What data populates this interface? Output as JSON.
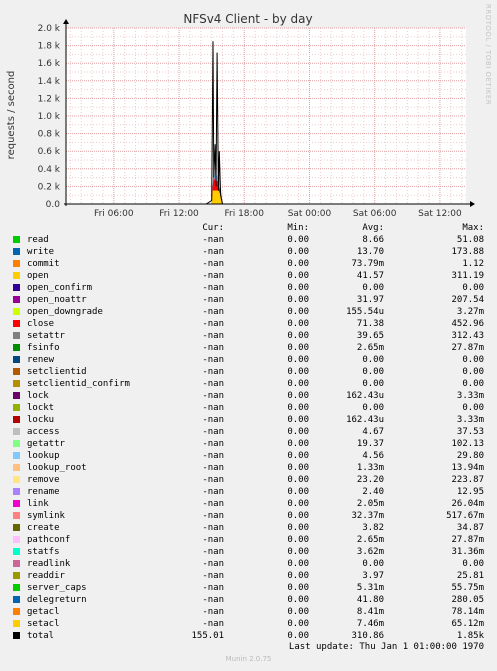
{
  "chart_data": {
    "type": "area",
    "title": "NFSv4 Client - by day",
    "ylabel": "requests / second",
    "ylim": [
      0,
      2000
    ],
    "yticks": [
      "0.0",
      "0.2 k",
      "0.4 k",
      "0.6 k",
      "0.8 k",
      "1.0 k",
      "1.2 k",
      "1.4 k",
      "1.6 k",
      "1.8 k",
      "2.0 k"
    ],
    "xticks": [
      "Fri 06:00",
      "Fri 12:00",
      "Fri 18:00",
      "Sat 00:00",
      "Sat 06:00",
      "Sat 12:00"
    ],
    "xticks_hours": [
      6,
      12,
      18,
      24,
      30,
      36
    ],
    "xlim_hours": [
      1.6,
      38.4
    ],
    "grid": true,
    "series": [
      {
        "name": "total",
        "x_hours": [
          12.0,
          13.5,
          14.5,
          15.0,
          15.12,
          15.2,
          15.32,
          15.4,
          15.5,
          15.62,
          15.7,
          15.82,
          16.0,
          17.0
        ],
        "y": [
          0,
          0,
          0,
          40,
          1850,
          300,
          680,
          200,
          1720,
          150,
          600,
          100,
          0,
          0
        ]
      },
      {
        "name": "lookup",
        "x_hours": [
          15.0,
          15.12,
          15.2,
          15.32,
          15.5,
          15.62,
          15.7,
          15.82,
          16.0
        ],
        "y": [
          0,
          220,
          420,
          260,
          320,
          250,
          400,
          180,
          0
        ]
      },
      {
        "name": "close",
        "x_hours": [
          15.0,
          15.12,
          15.2,
          15.32,
          15.5,
          15.62,
          15.8,
          16.0
        ],
        "y": [
          0,
          200,
          300,
          250,
          260,
          200,
          150,
          0
        ]
      },
      {
        "name": "open",
        "x_hours": [
          15.0,
          15.12,
          15.2,
          15.32,
          15.5,
          15.62,
          15.8,
          16.0
        ],
        "y": [
          0,
          150,
          150,
          150,
          150,
          150,
          100,
          0
        ]
      }
    ]
  },
  "legend": {
    "headers": {
      "cur": "Cur:",
      "min": "Min:",
      "avg": "Avg:",
      "max": "Max:"
    },
    "rows": [
      {
        "name": "read",
        "color": "#00cc00",
        "cur": "-nan",
        "min": "0.00",
        "avg": "8.66",
        "max": "51.08"
      },
      {
        "name": "write",
        "color": "#0066b3",
        "cur": "-nan",
        "min": "0.00",
        "avg": "13.70",
        "max": "173.88"
      },
      {
        "name": "commit",
        "color": "#ff8000",
        "cur": "-nan",
        "min": "0.00",
        "avg": "73.79m",
        "max": "1.12"
      },
      {
        "name": "open",
        "color": "#ffcc00",
        "cur": "-nan",
        "min": "0.00",
        "avg": "41.57",
        "max": "311.19"
      },
      {
        "name": "open_confirm",
        "color": "#330099",
        "cur": "-nan",
        "min": "0.00",
        "avg": "0.00",
        "max": "0.00"
      },
      {
        "name": "open_noattr",
        "color": "#990099",
        "cur": "-nan",
        "min": "0.00",
        "avg": "31.97",
        "max": "207.54"
      },
      {
        "name": "open_downgrade",
        "color": "#ccff00",
        "cur": "-nan",
        "min": "0.00",
        "avg": "155.54u",
        "max": "3.27m"
      },
      {
        "name": "close",
        "color": "#ff0000",
        "cur": "-nan",
        "min": "0.00",
        "avg": "71.38",
        "max": "452.96"
      },
      {
        "name": "setattr",
        "color": "#808080",
        "cur": "-nan",
        "min": "0.00",
        "avg": "39.65",
        "max": "312.43"
      },
      {
        "name": "fsinfo",
        "color": "#008f00",
        "cur": "-nan",
        "min": "0.00",
        "avg": "2.65m",
        "max": "27.87m"
      },
      {
        "name": "renew",
        "color": "#00487d",
        "cur": "-nan",
        "min": "0.00",
        "avg": "0.00",
        "max": "0.00"
      },
      {
        "name": "setclientid",
        "color": "#b35a00",
        "cur": "-nan",
        "min": "0.00",
        "avg": "0.00",
        "max": "0.00"
      },
      {
        "name": "setclientid_confirm",
        "color": "#b38f00",
        "cur": "-nan",
        "min": "0.00",
        "avg": "0.00",
        "max": "0.00"
      },
      {
        "name": "lock",
        "color": "#6b006b",
        "cur": "-nan",
        "min": "0.00",
        "avg": "162.43u",
        "max": "3.33m"
      },
      {
        "name": "lockt",
        "color": "#8fb300",
        "cur": "-nan",
        "min": "0.00",
        "avg": "0.00",
        "max": "0.00"
      },
      {
        "name": "locku",
        "color": "#b30000",
        "cur": "-nan",
        "min": "0.00",
        "avg": "162.43u",
        "max": "3.33m"
      },
      {
        "name": "access",
        "color": "#bebebe",
        "cur": "-nan",
        "min": "0.00",
        "avg": "4.67",
        "max": "37.53"
      },
      {
        "name": "getattr",
        "color": "#80ff80",
        "cur": "-nan",
        "min": "0.00",
        "avg": "19.37",
        "max": "102.13"
      },
      {
        "name": "lookup",
        "color": "#80c9ff",
        "cur": "-nan",
        "min": "0.00",
        "avg": "4.56",
        "max": "29.80"
      },
      {
        "name": "lookup_root",
        "color": "#ffc080",
        "cur": "-nan",
        "min": "0.00",
        "avg": "1.33m",
        "max": "13.94m"
      },
      {
        "name": "remove",
        "color": "#ffe680",
        "cur": "-nan",
        "min": "0.00",
        "avg": "23.20",
        "max": "223.87"
      },
      {
        "name": "rename",
        "color": "#aa80ff",
        "cur": "-nan",
        "min": "0.00",
        "avg": "2.40",
        "max": "12.95"
      },
      {
        "name": "link",
        "color": "#ee00cc",
        "cur": "-nan",
        "min": "0.00",
        "avg": "2.05m",
        "max": "26.04m"
      },
      {
        "name": "symlink",
        "color": "#ff8080",
        "cur": "-nan",
        "min": "0.00",
        "avg": "32.37m",
        "max": "517.67m"
      },
      {
        "name": "create",
        "color": "#666600",
        "cur": "-nan",
        "min": "0.00",
        "avg": "3.82",
        "max": "34.87"
      },
      {
        "name": "pathconf",
        "color": "#ffbfff",
        "cur": "-nan",
        "min": "0.00",
        "avg": "2.65m",
        "max": "27.87m"
      },
      {
        "name": "statfs",
        "color": "#00ffcc",
        "cur": "-nan",
        "min": "0.00",
        "avg": "3.62m",
        "max": "31.36m"
      },
      {
        "name": "readlink",
        "color": "#cc6699",
        "cur": "-nan",
        "min": "0.00",
        "avg": "0.00",
        "max": "0.00"
      },
      {
        "name": "readdir",
        "color": "#999900",
        "cur": "-nan",
        "min": "0.00",
        "avg": "3.97",
        "max": "25.81"
      },
      {
        "name": "server_caps",
        "color": "#00cc00",
        "cur": "-nan",
        "min": "0.00",
        "avg": "5.31m",
        "max": "55.75m"
      },
      {
        "name": "delegreturn",
        "color": "#0066b3",
        "cur": "-nan",
        "min": "0.00",
        "avg": "41.80",
        "max": "280.05"
      },
      {
        "name": "getacl",
        "color": "#ff8000",
        "cur": "-nan",
        "min": "0.00",
        "avg": "8.41m",
        "max": "78.14m"
      },
      {
        "name": "setacl",
        "color": "#ffcc00",
        "cur": "-nan",
        "min": "0.00",
        "avg": "7.46m",
        "max": "65.12m"
      },
      {
        "name": "total",
        "color": "#000000",
        "cur": "155.01",
        "min": "0.00",
        "avg": "310.86",
        "max": "1.85k"
      }
    ]
  },
  "last_update": "Last update: Thu Jan  1 01:00:00 1970",
  "footer": "Munin 2.0.75",
  "vendor": "RRDTOOL / TOBI OETIKER"
}
